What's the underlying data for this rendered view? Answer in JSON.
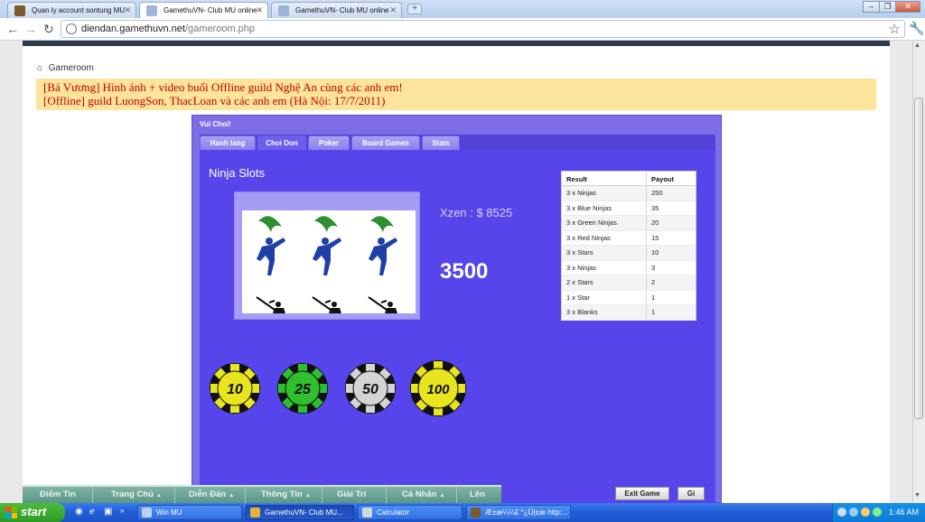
{
  "browser": {
    "tabs": [
      {
        "label": "Quan ly account sontung MU"
      },
      {
        "label": "GamethuVN- Club MU online -"
      },
      {
        "label": "GamethuVN- Club MU online"
      }
    ],
    "url_host": "diendan.gamethuvn.net",
    "url_path": "/gameroom.php"
  },
  "page": {
    "breadcrumb": "Gameroom",
    "notices": [
      "[Bá Vương] Hình ảnh + video buổi Offline guild Nghệ An cùng các anh em!",
      "[Offline] guild LuongSon, ThacLoan và các anh em (Hà Nội: 17/7/2011)"
    ]
  },
  "game": {
    "title": "Vui Choi!",
    "tabs": [
      "Hanh lang",
      "Choi Don",
      "Poker",
      "Board Games",
      "Stats"
    ],
    "active_tab": "Choi Don",
    "slots_title": "Ninja Slots",
    "balance": "Xzen : $  8525",
    "amount": "3500",
    "payout_headers": [
      "Result",
      "Payout"
    ],
    "payout_rows": [
      [
        "3 x  Ninjas",
        "250"
      ],
      [
        "3 x Blue Ninjas",
        "35"
      ],
      [
        "3 x Green Ninjas",
        "20"
      ],
      [
        "3 x Red Ninjas",
        "15"
      ],
      [
        "3 x Stars",
        "10"
      ],
      [
        "3 x Ninjas",
        "3"
      ],
      [
        "2 x Stars",
        "2"
      ],
      [
        "1 x Star",
        "1"
      ],
      [
        "3 x Blanks",
        "1"
      ]
    ],
    "chips": [
      {
        "label": "10",
        "color": "#e8e41e"
      },
      {
        "label": "25",
        "color": "#2fbf2f"
      },
      {
        "label": "50",
        "color": "#d4d4d4"
      },
      {
        "label": "100",
        "color": "#e8e41e"
      }
    ],
    "exit_label": "Exit Game",
    "send_label": "Gi"
  },
  "sitenav": [
    "Điểm Tin",
    "Trang Chủ",
    "Diễn Đàn",
    "Thông Tin",
    "Giải Trí",
    "Cá Nhân",
    "Lên"
  ],
  "taskbar": {
    "start": "start",
    "tasks": [
      "Win MU",
      "GamethuVN- Club MU...",
      "Calculator",
      "Æ±æ¼¼£ °¿Ü|±æ http:..."
    ],
    "clock": "1:46 AM"
  },
  "colors": {
    "notice_text": "#c20000",
    "game_bg": "#5645ea",
    "taskbar": "#235dd6"
  }
}
